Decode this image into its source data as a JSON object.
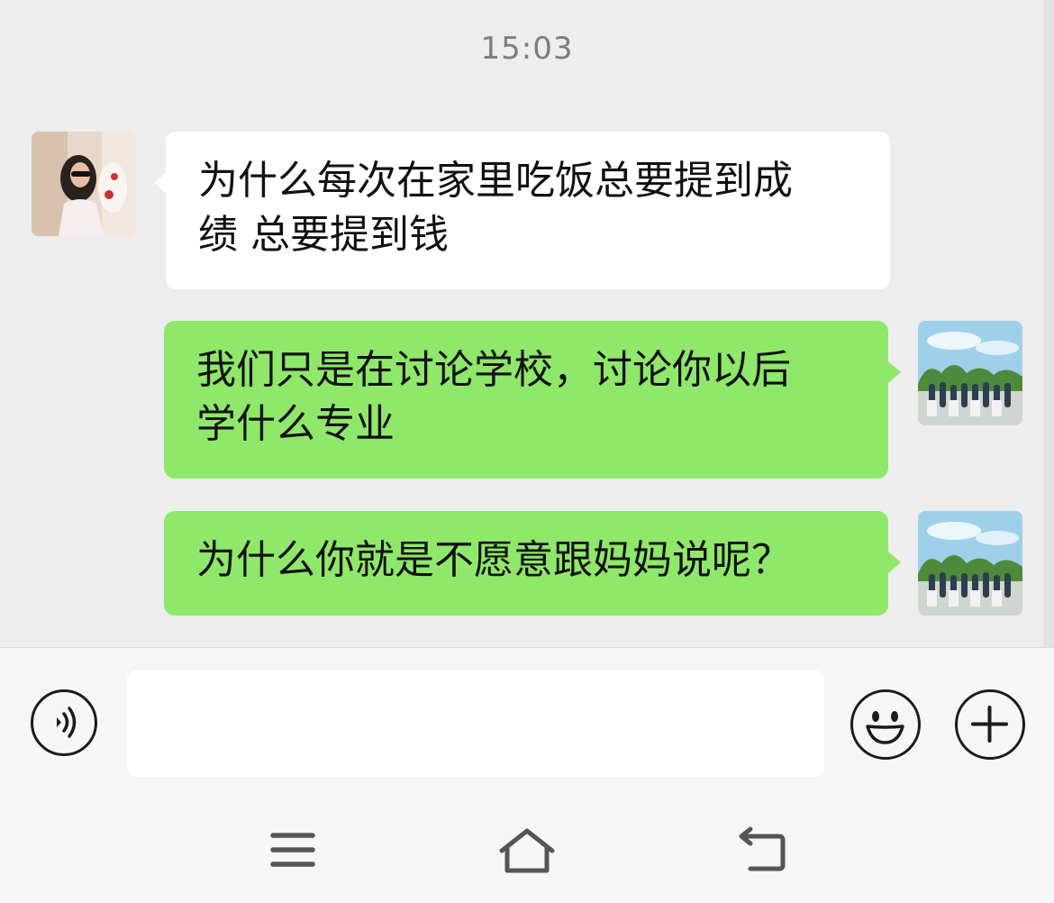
{
  "chat": {
    "timestamp": "15:03",
    "messages": [
      {
        "sender": "contact",
        "lines": [
          "为什么每次在家里吃饭总要提到成",
          "绩 总要提到钱"
        ]
      },
      {
        "sender": "me",
        "lines": [
          "我们只是在讨论学校，讨论你以后",
          "学什么专业"
        ]
      },
      {
        "sender": "me",
        "lines": [
          "为什么你就是不愿意跟妈妈说呢？"
        ]
      }
    ]
  },
  "input_bar": {
    "voice_icon": "voice-icon",
    "message_value": "",
    "emoji_icon": "emoji-icon",
    "more_icon": "plus-icon"
  },
  "nav_bar": {
    "icons": [
      "menu-icon",
      "home-icon",
      "back-icon"
    ]
  },
  "colors": {
    "chat_background": "#ededed",
    "incoming_bubble": "#ffffff",
    "outgoing_bubble": "#8fe86a",
    "icon_stroke": "#1b1b1b"
  }
}
